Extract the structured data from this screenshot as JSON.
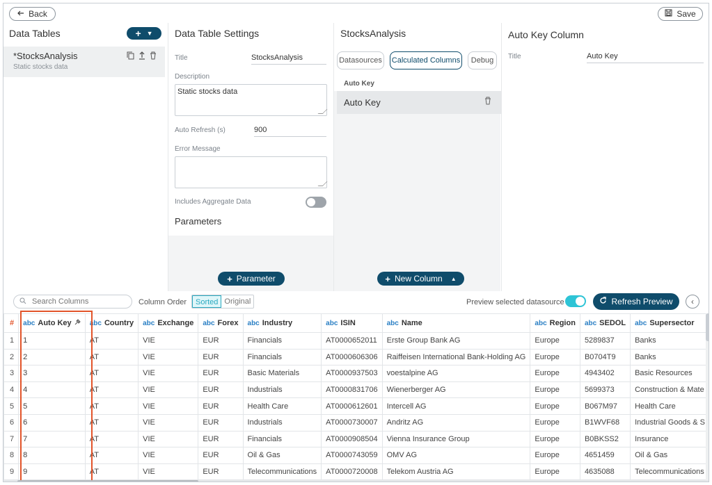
{
  "topbar": {
    "back_label": "Back",
    "save_label": "Save"
  },
  "data_tables": {
    "title": "Data Tables",
    "items": [
      {
        "name": "*StocksAnalysis",
        "description": "Static stocks data"
      }
    ]
  },
  "settings": {
    "title": "Data Table Settings",
    "title_label": "Title",
    "title_value": "StocksAnalysis",
    "description_label": "Description",
    "description_value": "Static stocks data",
    "auto_refresh_label": "Auto Refresh (s)",
    "auto_refresh_value": "900",
    "error_label": "Error Message",
    "error_value": "",
    "aggregate_label": "Includes Aggregate Data",
    "aggregate_on": false,
    "parameters_title": "Parameters",
    "add_parameter_label": "Parameter"
  },
  "stocks_analysis": {
    "title": "StocksAnalysis",
    "tabs": [
      "Datasources",
      "Calculated Columns",
      "Debug"
    ],
    "active_tab": "Calculated Columns",
    "section_header": "Auto Key",
    "columns": [
      "Auto Key"
    ],
    "new_column_label": "New Column"
  },
  "auto_key_column": {
    "title": "Auto Key Column",
    "title_label": "Title",
    "title_value": "Auto Key"
  },
  "preview": {
    "search_placeholder": "Search Columns",
    "column_order_label": "Column Order",
    "order_options": [
      "Sorted",
      "Original"
    ],
    "order_selected": "Sorted",
    "preview_label": "Preview selected datasource",
    "preview_on": true,
    "refresh_label": "Refresh Preview",
    "type_tag": "abc",
    "hash": "#",
    "headers": [
      "Auto Key",
      "Country",
      "Exchange",
      "Forex",
      "Industry",
      "ISIN",
      "Name",
      "Region",
      "SEDOL",
      "Supersector"
    ],
    "rows": [
      [
        "1",
        "1",
        "AT",
        "VIE",
        "EUR",
        "Financials",
        "AT0000652011",
        "Erste Group Bank AG",
        "Europe",
        "5289837",
        "Banks"
      ],
      [
        "2",
        "2",
        "AT",
        "VIE",
        "EUR",
        "Financials",
        "AT0000606306",
        "Raiffeisen International Bank-Holding AG",
        "Europe",
        "B0704T9",
        "Banks"
      ],
      [
        "3",
        "3",
        "AT",
        "VIE",
        "EUR",
        "Basic Materials",
        "AT0000937503",
        "voestalpine AG",
        "Europe",
        "4943402",
        "Basic Resources"
      ],
      [
        "4",
        "4",
        "AT",
        "VIE",
        "EUR",
        "Industrials",
        "AT0000831706",
        "Wienerberger AG",
        "Europe",
        "5699373",
        "Construction & Mate"
      ],
      [
        "5",
        "5",
        "AT",
        "VIE",
        "EUR",
        "Health Care",
        "AT0000612601",
        "Intercell AG",
        "Europe",
        "B067M97",
        "Health Care"
      ],
      [
        "6",
        "6",
        "AT",
        "VIE",
        "EUR",
        "Industrials",
        "AT0000730007",
        "Andritz AG",
        "Europe",
        "B1WVF68",
        "Industrial Goods & S"
      ],
      [
        "7",
        "7",
        "AT",
        "VIE",
        "EUR",
        "Financials",
        "AT0000908504",
        "Vienna Insurance Group",
        "Europe",
        "B0BKSS2",
        "Insurance"
      ],
      [
        "8",
        "8",
        "AT",
        "VIE",
        "EUR",
        "Oil & Gas",
        "AT0000743059",
        "OMV AG",
        "Europe",
        "4651459",
        "Oil & Gas"
      ],
      [
        "9",
        "9",
        "AT",
        "VIE",
        "EUR",
        "Telecommunications",
        "AT0000720008",
        "Telekom Austria AG",
        "Europe",
        "4635088",
        "Telecommunications"
      ]
    ]
  },
  "colors": {
    "brand": "#0f4c6b",
    "accent": "#2ec4d6",
    "highlight": "#e2542a"
  }
}
